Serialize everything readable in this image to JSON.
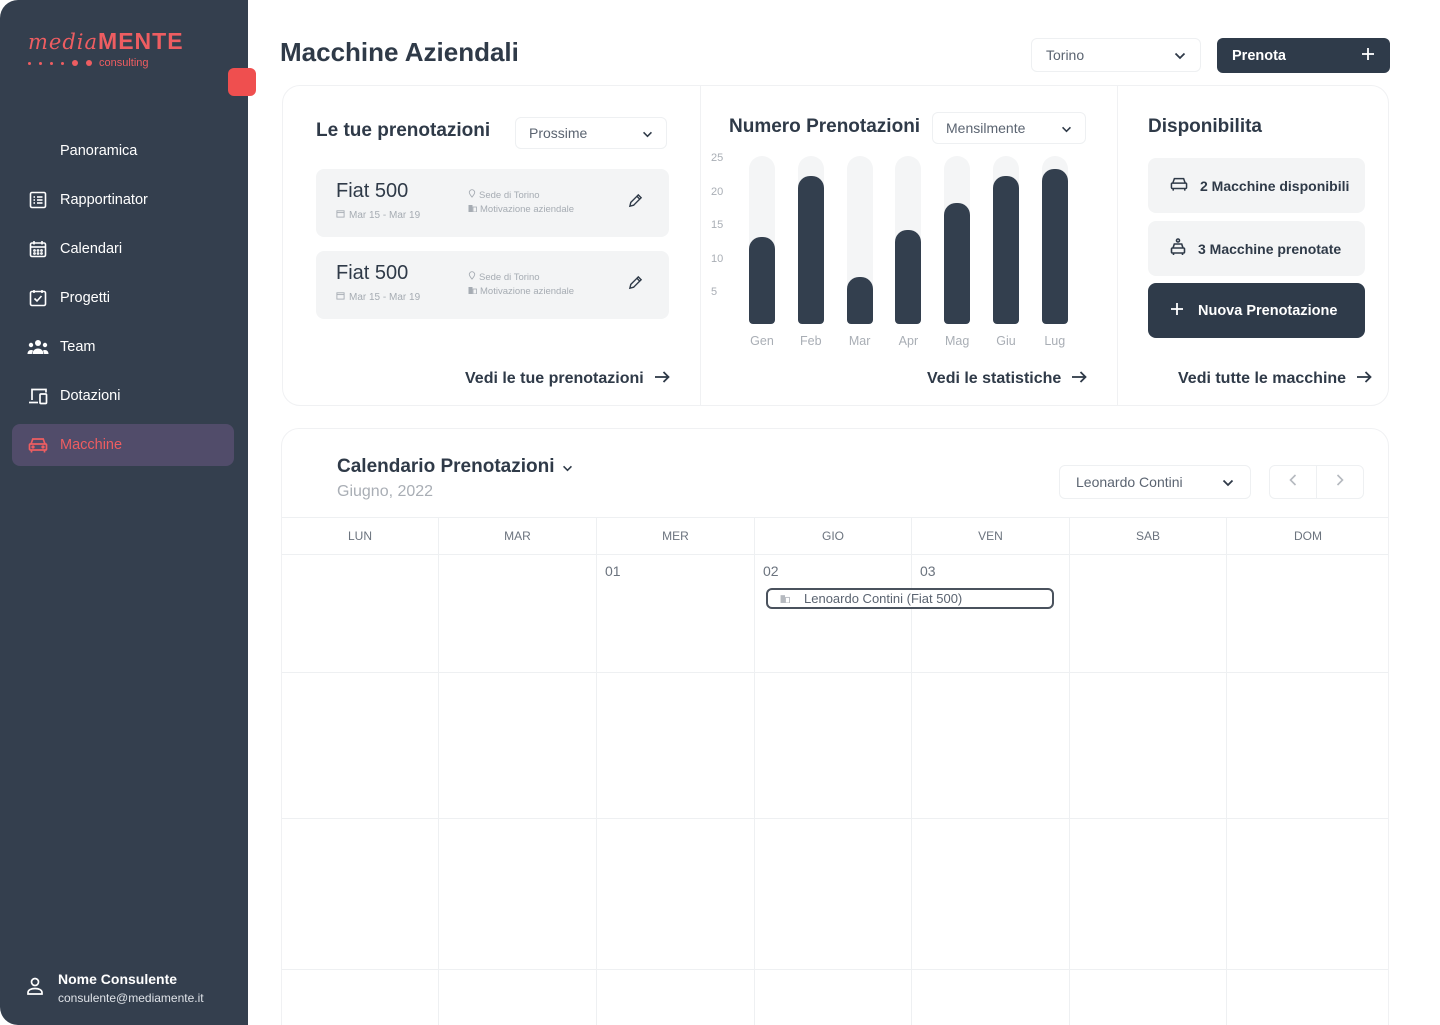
{
  "brand": {
    "logo_italic": "media",
    "logo_caps": "MENTE",
    "logo_sub": "consulting",
    "accent": "#ee5d61",
    "sidebar_bg": "#343f4e"
  },
  "sidebar": {
    "items": [
      {
        "label": "Panoramica",
        "icon": "none"
      },
      {
        "label": "Rapportinator",
        "icon": "list-icon"
      },
      {
        "label": "Calendari",
        "icon": "calendar-icon"
      },
      {
        "label": "Progetti",
        "icon": "checkbox-icon"
      },
      {
        "label": "Team",
        "icon": "team-icon"
      },
      {
        "label": "Dotazioni",
        "icon": "devices-icon"
      },
      {
        "label": "Macchine",
        "icon": "car-icon",
        "active": true
      }
    ],
    "user": {
      "name": "Nome Consulente",
      "email": "consulente@mediamente.it"
    }
  },
  "header": {
    "title": "Macchine Aziendali",
    "location": "Torino",
    "book_button": "Prenota"
  },
  "bookings": {
    "title": "Le tue prenotazioni",
    "filter": "Prossime",
    "items": [
      {
        "car": "Fiat 500",
        "dates": "Mar 15 - Mar 19",
        "place": "Sede di Torino",
        "reason": "Motivazione aziendale"
      },
      {
        "car": "Fiat 500",
        "dates": "Mar 15 - Mar 19",
        "place": "Sede di Torino",
        "reason": "Motivazione aziendale"
      }
    ],
    "link": "Vedi le tue prenotazioni"
  },
  "stats": {
    "title": "Numero Prenotazioni",
    "period": "Mensilmente",
    "link": "Vedi le statistiche"
  },
  "chart_data": {
    "type": "bar",
    "categories": [
      "Gen",
      "Feb",
      "Mar",
      "Apr",
      "Mag",
      "Giu",
      "Lug"
    ],
    "values": [
      13,
      22,
      7,
      14,
      18,
      22,
      23
    ],
    "yticks": [
      5,
      10,
      15,
      20,
      25
    ],
    "ylim": [
      0,
      25
    ],
    "title": "Numero Prenotazioni",
    "bar_color": "#333f4e"
  },
  "availability": {
    "title": "Disponibilita",
    "available": "2 Macchine disponibili",
    "booked": "3 Macchine prenotate",
    "new_button": "Nuova Prenotazione",
    "link": "Vedi tutte le macchine"
  },
  "calendar": {
    "title": "Calendario Prenotazioni",
    "month": "Giugno, 2022",
    "person": "Leonardo Contini",
    "days": [
      "LUN",
      "MAR",
      "MER",
      "GIO",
      "VEN",
      "SAB",
      "DOM"
    ],
    "rows": [
      [
        "",
        "",
        "01",
        "02",
        "03",
        "",
        ""
      ],
      [
        "",
        "",
        "",
        "",
        "",
        "",
        ""
      ],
      [
        "",
        "",
        "",
        "",
        "",
        "",
        ""
      ],
      [
        "",
        "",
        "",
        "",
        "",
        "",
        ""
      ]
    ],
    "event": "Lenoardo Contini (Fiat 500)"
  }
}
